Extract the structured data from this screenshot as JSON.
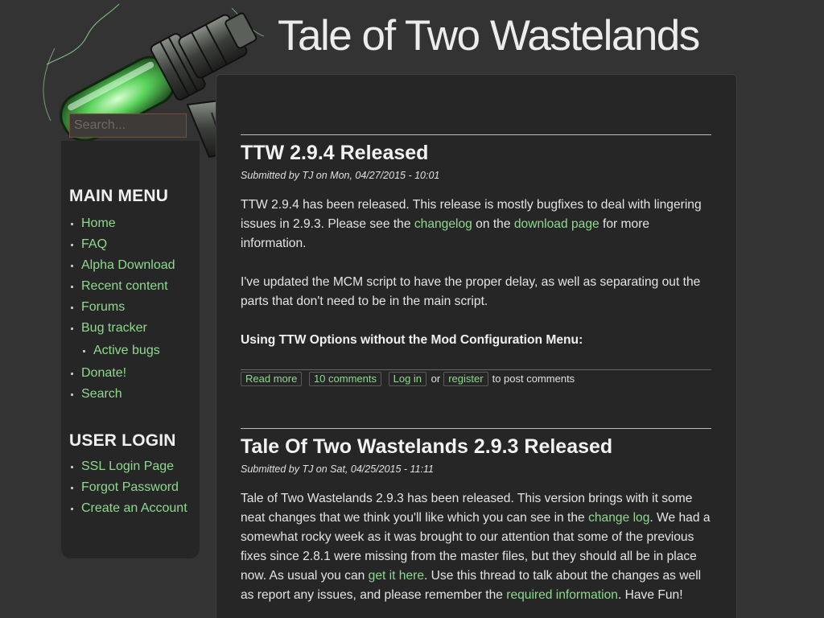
{
  "site": {
    "title": "Tale of Two Wastelands"
  },
  "search": {
    "placeholder": "Search..."
  },
  "sidebar": {
    "main_menu": {
      "title": "MAIN MENU",
      "items": [
        {
          "label": "Home"
        },
        {
          "label": "FAQ"
        },
        {
          "label": "Alpha Download"
        },
        {
          "label": "Recent content"
        },
        {
          "label": "Forums"
        },
        {
          "label": "Bug tracker"
        },
        {
          "label": "Active bugs"
        },
        {
          "label": "Donate!"
        },
        {
          "label": "Search"
        }
      ]
    },
    "user_login": {
      "title": "USER LOGIN",
      "items": [
        {
          "label": "SSL Login Page"
        },
        {
          "label": "Forgot Password"
        },
        {
          "label": "Create an Account"
        }
      ]
    }
  },
  "posts": [
    {
      "title": "TTW 2.9.4 Released",
      "submitted": "Submitted by TJ on Mon, 04/27/2015 - 10:01",
      "p1_a": "TTW 2.9.4 has been released. This release is mostly bugfixes to deal with lingering issues in 2.9.3. Please see the ",
      "p1_link1": "changelog",
      "p1_b": " on the ",
      "p1_link2": "download page",
      "p1_c": " for more information.",
      "p2": "I've updated the MCM script to have the proper delay, as well as separating out the parts that don't need to be in the main script.",
      "p3": "Using TTW Options without the Mod Configuration Menu:",
      "links": {
        "read_more": "Read more",
        "comments": "10 comments",
        "login": "Log in",
        "or": "or",
        "register": "register",
        "suffix": "to post comments"
      }
    },
    {
      "title": "Tale Of Two Wastelands 2.9.3 Released",
      "submitted": "Submitted by TJ on Sat, 04/25/2015 - 11:11",
      "p1_a": "Tale of Two Wastelands 2.9.3 has been released. This version brings with it some neat changes that we think you'll like which you can see in the ",
      "p1_link1": "change log",
      "p1_b": ". We had a somewhat rocky week as it was brought to our attention that some of the previous fixes since 2.8.1 were missing from the master files, but they should all be in place now. As usual you can ",
      "p1_link2": "get it here",
      "p1_c": ". Use this thread to talk about the changes as well as report any issues, and please remember the ",
      "p1_link3": "required information",
      "p1_d": ". Have Fun!"
    }
  ],
  "colors": {
    "page_bg": "#333333",
    "panel_bg": "#262626",
    "link": "#8ed98e",
    "text": "#e6e6e6"
  }
}
